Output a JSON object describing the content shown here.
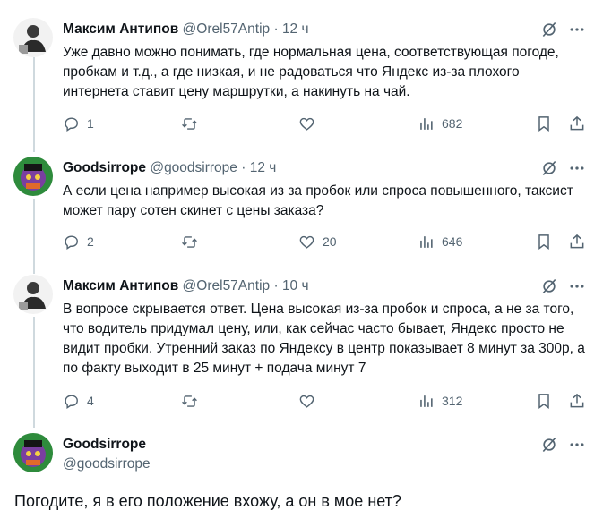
{
  "tweets": [
    {
      "name": "Максим Антипов",
      "handle": "@Orel57Antip",
      "sep": "·",
      "time": "12 ч",
      "text": "Уже давно можно понимать, где нормальная цена, соответствующая погоде, пробкам и т.д., а где низкая, и не радоваться что Яндекс из-за плохого интернета ставит цену маршрутки, а накинуть на чай.",
      "replies": "1",
      "retweets": "",
      "likes": "",
      "views": "682"
    },
    {
      "name": "Goodsirrope",
      "handle": "@goodsirrope",
      "sep": "·",
      "time": "12 ч",
      "text": "А если цена например высокая из за пробок или  спроса повышенного, таксист может пару сотен скинет с цены заказа?",
      "replies": "2",
      "retweets": "",
      "likes": "20",
      "views": "646"
    },
    {
      "name": "Максим Антипов",
      "handle": "@Orel57Antip",
      "sep": "·",
      "time": "10 ч",
      "text": "В вопросе скрывается ответ. Цена высокая из-за пробок и спроса, а не за того, что водитель придумал цену, или, как сейчас часто бывает, Яндекс просто не видит пробки. Утренний заказ по Яндексу в центр показывает 8 минут за 300р, а по факту выходит в 25 минут + подача минут 7",
      "replies": "4",
      "retweets": "",
      "likes": "",
      "views": "312"
    }
  ],
  "focus": {
    "name": "Goodsirrope",
    "handle": "@goodsirrope",
    "text": "Погодите, я в его положение вхожу, а он в мое нет?"
  },
  "icons": {
    "more": "more-dots-icon",
    "grok": "grok-slash-circle-icon",
    "reply": "reply-bubble-icon",
    "retweet": "retweet-icon",
    "like": "heart-icon",
    "views": "views-bar-chart-icon",
    "bookmark": "bookmark-icon",
    "share": "share-upload-icon"
  },
  "colors": {
    "text": "#0f1419",
    "secondary": "#536471",
    "thread": "#cfd9de"
  }
}
